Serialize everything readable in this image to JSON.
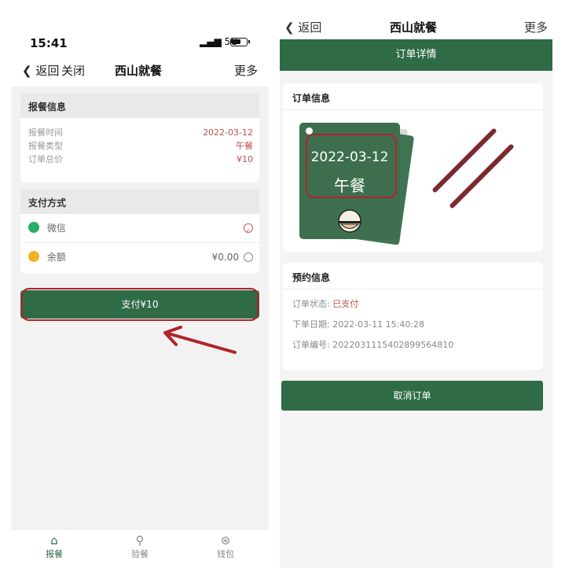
{
  "left_phone": {
    "status_bar": {
      "time": "15:41",
      "signal": "5G"
    },
    "nav": {
      "back": "返回",
      "close": "关闭",
      "title": "西山就餐",
      "more": "更多"
    },
    "order_info": {
      "header": "报餐信息",
      "rows": [
        {
          "label": "报餐时间",
          "value": "2022-03-12"
        },
        {
          "label": "报餐类型",
          "value": "午餐"
        },
        {
          "label": "订单总价",
          "value": "¥10"
        }
      ]
    },
    "payment": {
      "header": "支付方式",
      "wechat": "微信",
      "balance": "余额",
      "balance_value": "¥0.00"
    },
    "pay_button": "支付¥10",
    "tabs": [
      {
        "label": "报餐",
        "icon": "store-icon"
      },
      {
        "label": "验餐",
        "icon": "search-icon"
      },
      {
        "label": "钱包",
        "icon": "yuan-icon"
      }
    ],
    "accent": "#2f6b45"
  },
  "right_phone": {
    "nav": {
      "back": "返回",
      "title": "西山就餐",
      "more": "更多"
    },
    "header": "订单详情",
    "order_card": {
      "header": "订单信息",
      "date": "2022-03-12",
      "meal": "午餐"
    },
    "reserve_card": {
      "header": "预约信息",
      "status_label": "订单状态:",
      "status_value": "已支付",
      "date_label": "下单日期:",
      "date_value": "2022-03-11 15:40:28",
      "id_label": "订单编号:",
      "id_value": "20220311154028995648​10"
    },
    "cancel_button": "取消订单"
  }
}
